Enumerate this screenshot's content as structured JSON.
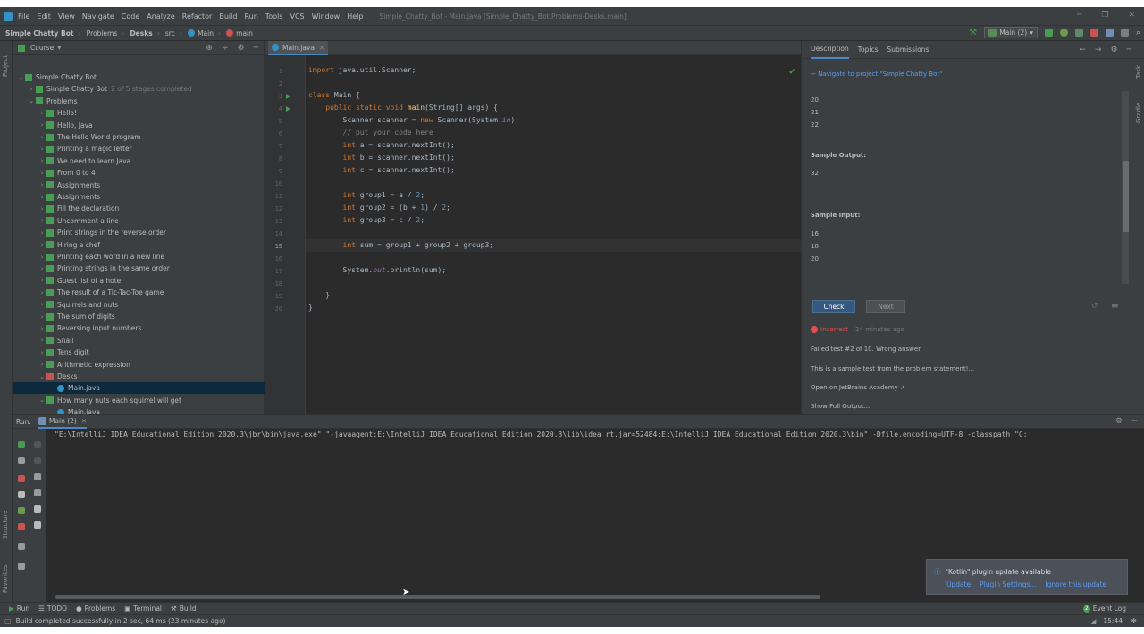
{
  "menu": {
    "items": [
      "File",
      "Edit",
      "View",
      "Navigate",
      "Code",
      "Analyze",
      "Refactor",
      "Build",
      "Run",
      "Tools",
      "VCS",
      "Window",
      "Help"
    ],
    "window_title": "Simple_Chatty_Bot - Main.java [Simple_Chatty_Bot.Problems-Desks.main]"
  },
  "breadcrumbs": [
    "Simple Chatty Bot",
    "Problems",
    "Desks",
    "src",
    "Main",
    "main"
  ],
  "run_config": "Main (2)",
  "project": {
    "header": "Course",
    "root": "Simple Chatty Bot",
    "section_bot": "Simple Chatty Bot",
    "section_bot_progress": "2 of 5 stages completed",
    "problems_label": "Problems",
    "problems": [
      "Hello!",
      "Hello, Java",
      "The Hello World program",
      "Printing a magic letter",
      "We need to learn Java",
      "From 0 to 4",
      "Assignments",
      "Assignments",
      "Fill the declaration",
      "Uncomment a line",
      "Print strings in the reverse order",
      "Hiring a chef",
      "Printing each word in a new line",
      "Printing strings in the same order",
      "Guest list of a hotel",
      "The result of a Tic-Tac-Toe game",
      "Squirrels and nuts",
      "The sum of digits",
      "Reversing input numbers",
      "Snail",
      "Tens digit",
      "Arithmetic expression"
    ],
    "desks": "Desks",
    "desks_file": "Main.java",
    "nuts": "How many nuts each squirrel will get",
    "nuts_file": "Main.java"
  },
  "editor": {
    "tab": "Main.java",
    "line_numbers": [
      "1",
      "2",
      "3",
      "4",
      "5",
      "6",
      "7",
      "8",
      "9",
      "10",
      "11",
      "12",
      "13",
      "14",
      "15",
      "16",
      "17",
      "18",
      "19",
      "20"
    ],
    "current_line": 15
  },
  "task": {
    "tabs": [
      "Description",
      "Topics",
      "Submissions"
    ],
    "navigate_link": "Navigate to project \"Simple Chatty Bot\"",
    "input_top": [
      "20",
      "21",
      "22"
    ],
    "sample_output_label": "Sample Output:",
    "sample_output": "32",
    "sample_input_label": "Sample Input:",
    "input_bottom": [
      "16",
      "18",
      "20"
    ],
    "check_button": "Check",
    "next_button": "Next",
    "status": "Incorrect",
    "status_time": "24 minutes ago",
    "failed": "Failed test #2 of 10. Wrong answer",
    "sample_note": "This is a sample test from the problem statement!...",
    "open_link": "Open on JetBrains Academy ↗",
    "full_output": "Show Full Output..."
  },
  "run": {
    "label": "Run:",
    "tab": "Main (2)",
    "command": "\"E:\\IntelliJ IDEA Educational Edition 2020.3\\jbr\\bin\\java.exe\" \"-javaagent:E:\\IntelliJ IDEA Educational Edition 2020.3\\lib\\idea_rt.jar=52484:E:\\IntelliJ IDEA Educational Edition 2020.3\\bin\" -Dfile.encoding=UTF-8 -classpath \"C:"
  },
  "notification": {
    "title": "\"Kotlin\" plugin update available",
    "actions": [
      "Update",
      "Plugin Settings...",
      "Ignore this update"
    ]
  },
  "tool_tabs": [
    "Run",
    "TODO",
    "Problems",
    "Terminal",
    "Build"
  ],
  "event_log": "Event Log",
  "event_count": "2",
  "status_text": "Build completed successfully in 2 sec, 64 ms (23 minutes ago)",
  "time": "15:44",
  "side_labels": {
    "project": "Project",
    "structure": "Structure",
    "favorites": "Favorites",
    "task": "Task",
    "gradle": "Gradle"
  },
  "colors": {
    "accent": "#4a88c7",
    "success": "#499c54",
    "error": "#e24f4f",
    "link": "#589df6"
  }
}
